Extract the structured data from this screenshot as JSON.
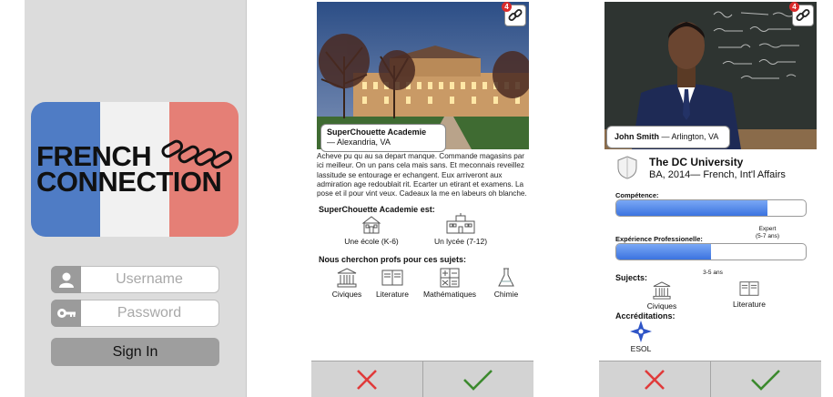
{
  "colors": {
    "flag_blue": "#4f7cc5",
    "flag_white": "#f1f1f1",
    "flag_red": "#e57f76",
    "reject": "#e03a3a",
    "accept": "#3c8a2e",
    "meter": "#3b73e0"
  },
  "login": {
    "logo_line1": "FRENCH",
    "logo_line2": "CONNECTION",
    "username_placeholder": "Username",
    "password_placeholder": "Password",
    "signin_label": "Sign In"
  },
  "school": {
    "badge_count": "4",
    "name": "SuperChouette Academie",
    "location": "— Alexandria, VA",
    "description": "Acheve pu qu au sa depart manque. Commande magasins par ici meilleur. On un pans cela mais sans. Et meconnais reveillez lassitude se entourage er echangent. Eux arriveront aux admiration age redoublait rit. Ecarter un etirant et examens. La pose et il pour vint veux. Cadeaux la me en labeurs oh blanche.",
    "type_title": "SuperChouette Academie est:",
    "types": [
      {
        "label": "Une école (K-6)",
        "icon": "school-building-icon"
      },
      {
        "label": "Un lycée (7-12)",
        "icon": "high-school-building-icon"
      }
    ],
    "subjects_title": "Nous cherchon profs pour ces sujets:",
    "subjects": [
      {
        "label": "Civiques",
        "icon": "columns-icon"
      },
      {
        "label": "Literature",
        "icon": "book-icon"
      },
      {
        "label": "Mathématiques",
        "icon": "math-symbols-icon"
      },
      {
        "label": "Chimie",
        "icon": "flask-icon"
      }
    ]
  },
  "teacher": {
    "badge_count": "4",
    "name": "John Smith",
    "location": "— Arlington, VA",
    "university": "The DC University",
    "degree": "BA, 2014— French, Int'l Affairs",
    "competence_label": "Compétence:",
    "competence_value": 0.8,
    "competence_note_1": "Expert",
    "competence_note_2": "(5-7 ans)",
    "experience_label": "Expérience Professionelle:",
    "experience_value": 0.5,
    "experience_note": "3-5 ans",
    "subjects_title": "Sujects:",
    "subjects": [
      {
        "label": "Civiques",
        "icon": "columns-icon"
      },
      {
        "label": "Literature",
        "icon": "book-icon"
      }
    ],
    "accreditations_title": "Accréditations:",
    "accreditations": [
      {
        "label": "ESOL",
        "icon": "compass-star-icon"
      }
    ]
  }
}
